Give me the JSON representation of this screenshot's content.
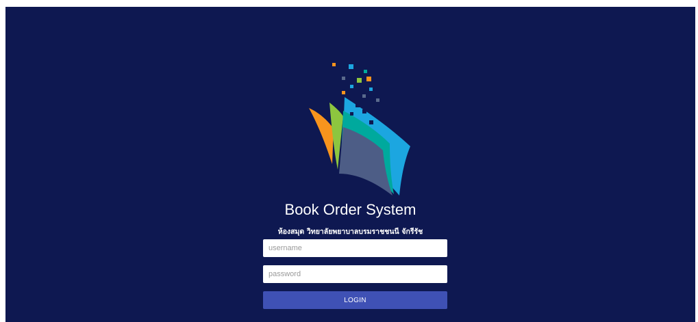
{
  "app": {
    "title": "Book Order System",
    "subtitle": "ห้องสมุด วิทยาลัยพยาบาลบรมราชชนนี จักรีรัช"
  },
  "login_form": {
    "username_placeholder": "username",
    "username_value": "",
    "password_placeholder": "password",
    "password_value": "",
    "login_label": "LOGIN"
  },
  "colors": {
    "background": "#0e1851",
    "button": "#3f51b5",
    "text": "#ffffff"
  },
  "logo": {
    "icon": "open-book-pixel-logo-icon"
  }
}
